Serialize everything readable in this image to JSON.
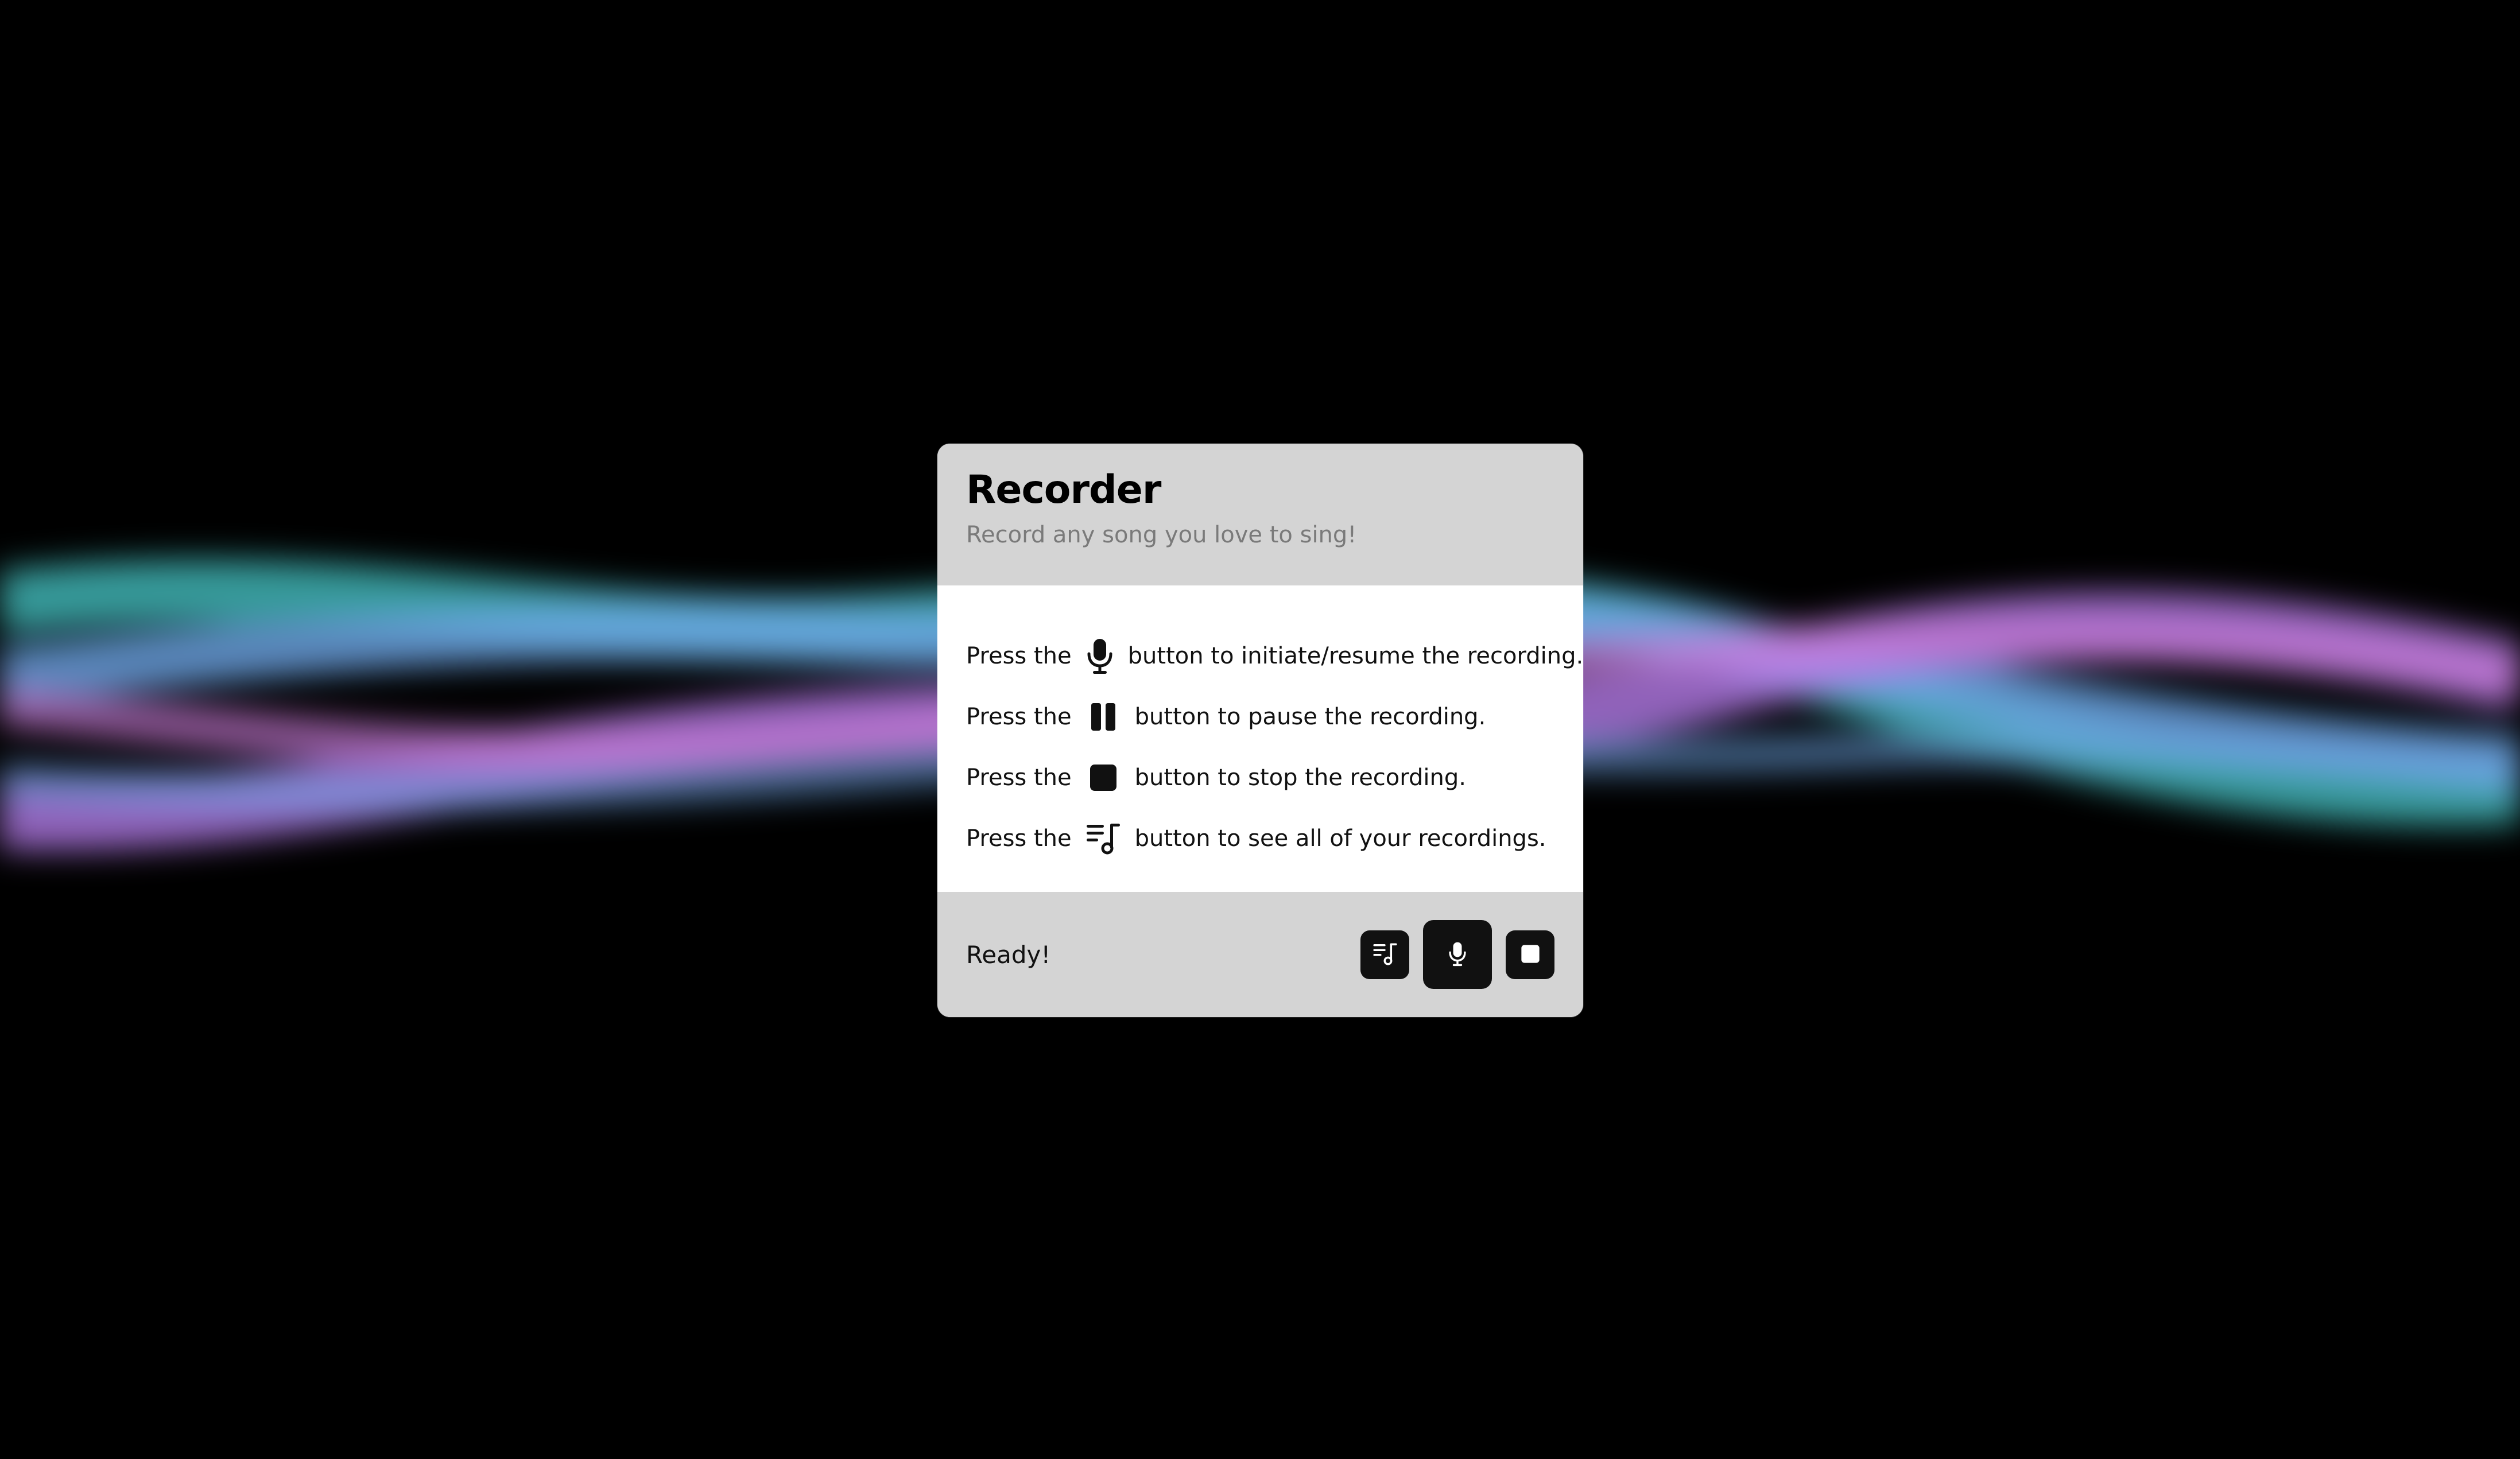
{
  "colors": {
    "background": "#000000",
    "card_header": "#d4d4d4",
    "card_body": "#ffffff",
    "button": "#111111",
    "wave_teal": "#3fb4b4",
    "wave_blue": "#6fa8e8",
    "wave_purple": "#b47ae8",
    "wave_magenta": "#c97ad6"
  },
  "card": {
    "title": "Recorder",
    "subtitle": "Record any song you love to sing!"
  },
  "instructions": [
    {
      "prefix": "Press the",
      "icon": "microphone-icon",
      "suffix": "button to initiate/resume the recording."
    },
    {
      "prefix": "Press the",
      "icon": "pause-icon",
      "suffix": "button to pause the recording."
    },
    {
      "prefix": "Press the",
      "icon": "stop-icon",
      "suffix": "button to stop the recording."
    },
    {
      "prefix": "Press the",
      "icon": "playlist-icon",
      "suffix": "button to see all of your recordings."
    }
  ],
  "footer": {
    "status": "Ready!",
    "buttons": [
      {
        "name": "recordings-button",
        "icon": "playlist-icon"
      },
      {
        "name": "record-button",
        "icon": "microphone-icon"
      },
      {
        "name": "stop-button",
        "icon": "stop-icon"
      }
    ]
  }
}
